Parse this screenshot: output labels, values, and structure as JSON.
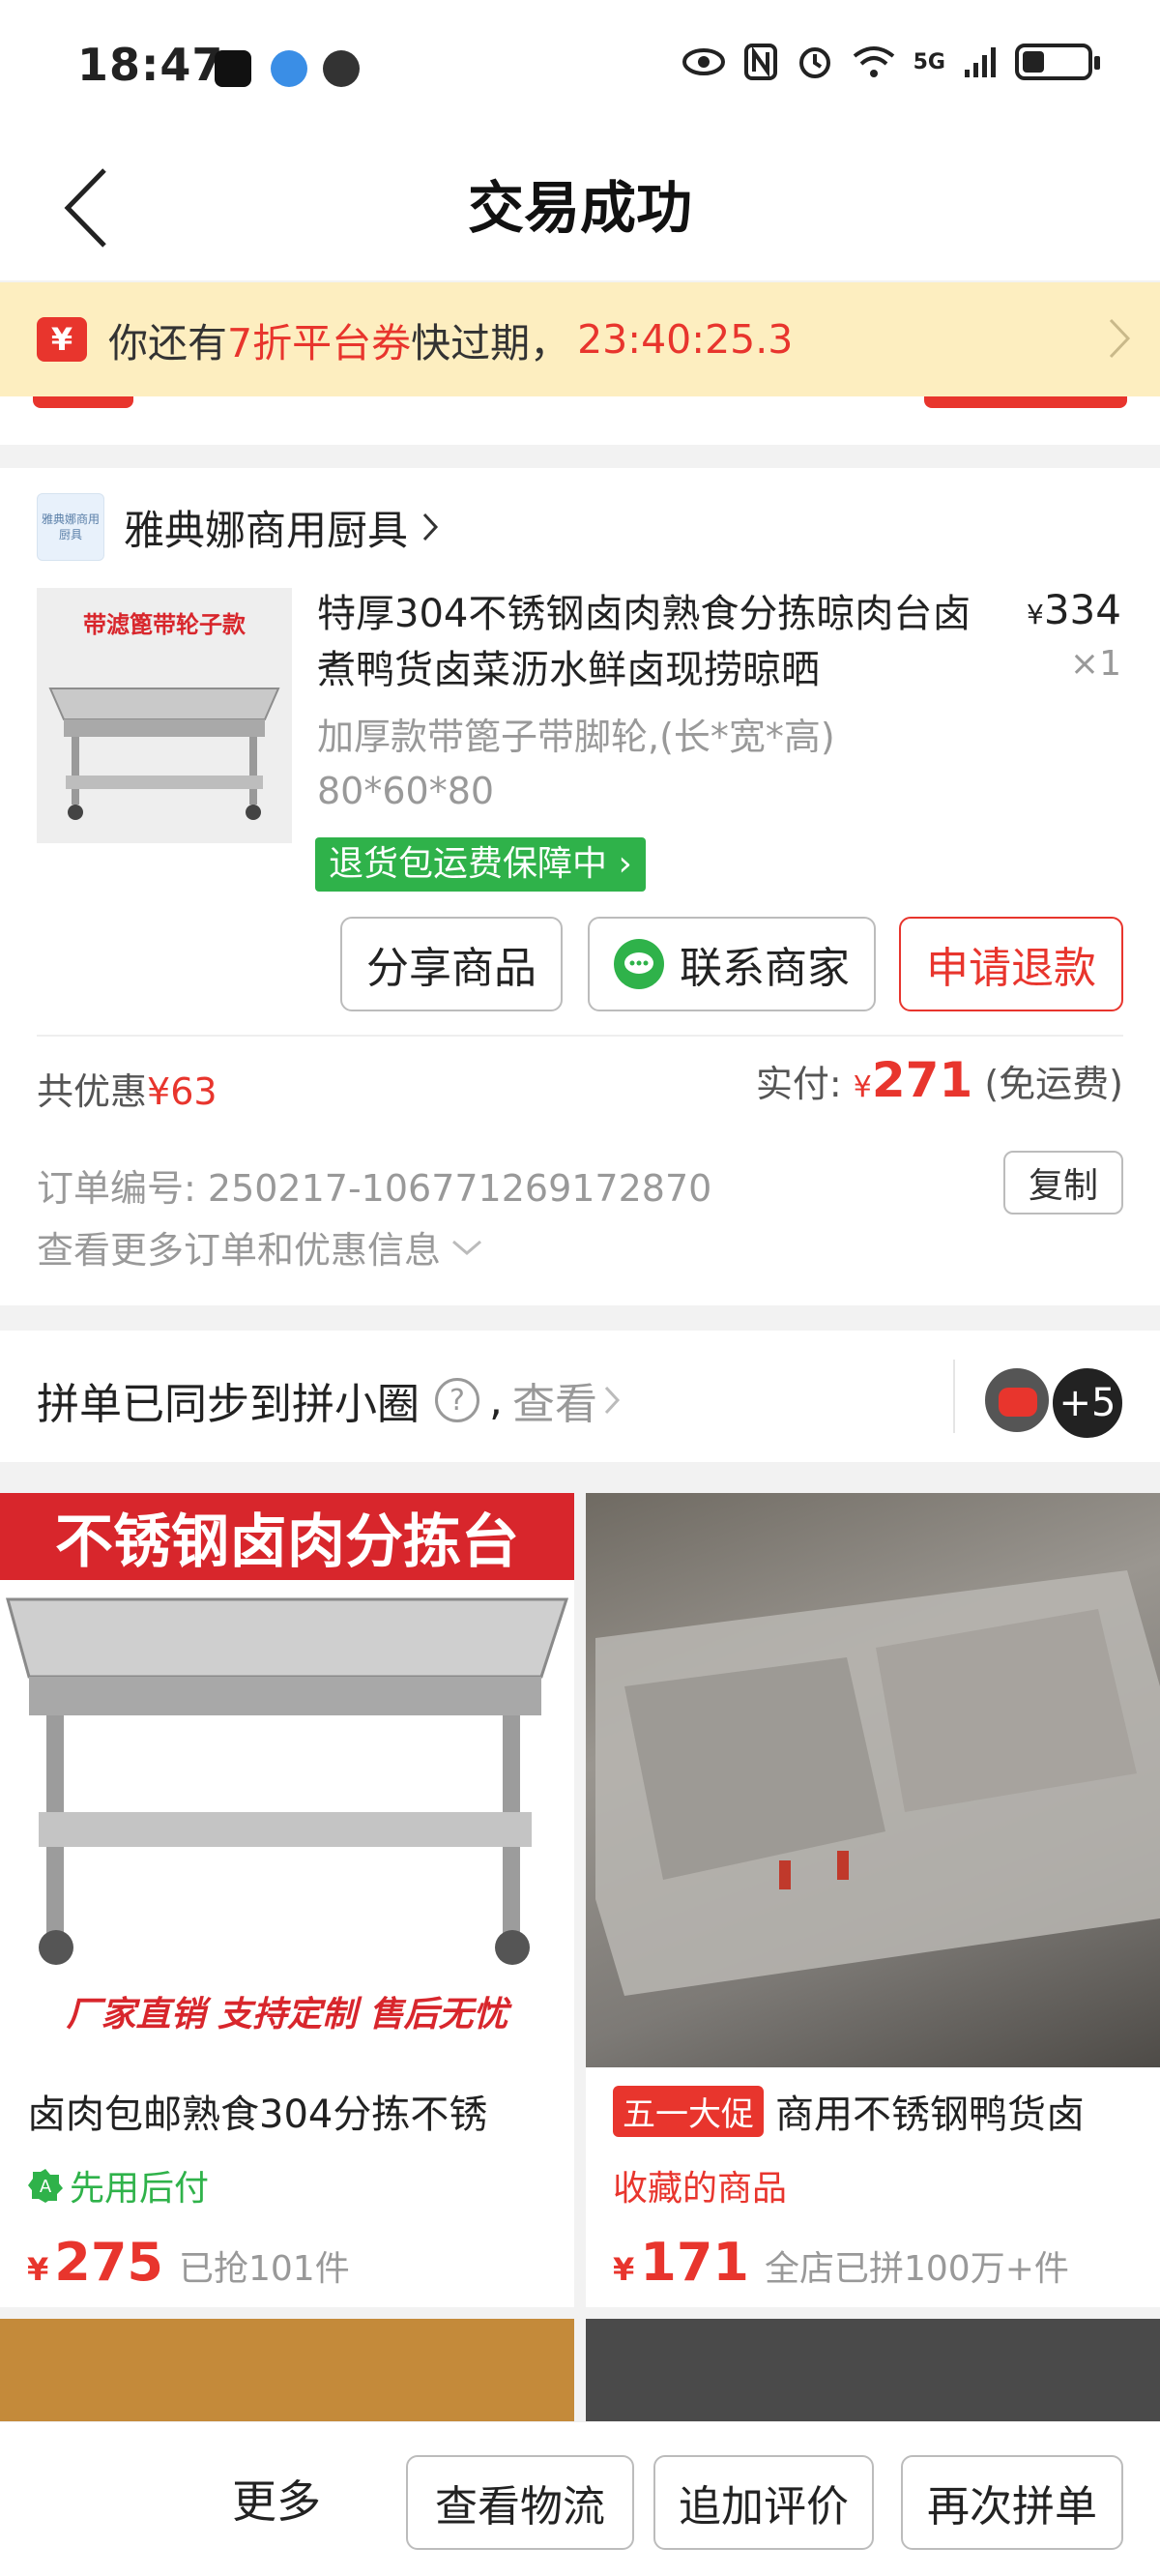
{
  "status_bar": {
    "time": "18:47",
    "network": "5G"
  },
  "nav": {
    "title": "交易成功"
  },
  "coupon": {
    "tag": "¥",
    "text_before": "你还有",
    "highlight": "7折平台券",
    "text_after": "快过期，",
    "countdown": "23:40:25.3"
  },
  "order": {
    "shop_logo_text": "雅典娜商用厨具",
    "shop_name": "雅典娜商用厨具",
    "image_caption": "带滤篦带轮子款",
    "title": "特厚304不锈钢卤肉熟食分拣晾肉台卤煮鸭货卤菜沥水鲜卤现捞晾晒",
    "currency": "¥",
    "price": "334",
    "quantity": "×1",
    "spec": "加厚款带篦子带脚轮,(长*宽*高) 80*60*80",
    "guarantee": "退货包运费保障中",
    "buttons": {
      "share": "分享商品",
      "contact": "联系商家",
      "refund": "申请退款"
    },
    "discount_label": "共优惠",
    "discount_value": "¥63",
    "paid_label": "实付: ",
    "paid_currency": "¥",
    "paid_amount": "271",
    "shipping": " (免运费)",
    "order_no_label": "订单编号: ",
    "order_no": "250217-106771269172870",
    "copy": "复制",
    "more_info": "查看更多订单和优惠信息"
  },
  "sync": {
    "text": "拼单已同步到拼小圈",
    "help": "?",
    "comma": ",",
    "look": "查看",
    "avatar_count": "+5"
  },
  "recommendations": [
    {
      "banner": "不锈钢卤肉分拣台",
      "slogan": "厂家直销  支持定制  售后无忧",
      "title": "卤肉包邮熟食304分拣不锈",
      "sub": "先用后付",
      "currency": "¥",
      "price": "275",
      "sold": "已抢101件"
    },
    {
      "promo": "五一大促",
      "title": "商用不锈钢鸭货卤",
      "sub": "收藏的商品",
      "currency": "¥",
      "price": "171",
      "sold": "全店已拼100万+件"
    }
  ],
  "bottom_bar": {
    "more": "更多",
    "logistics": "查看物流",
    "review": "追加评价",
    "reorder": "再次拼单"
  },
  "colors": {
    "accent": "#e8352d",
    "green": "#2fb24a",
    "coupon_bg": "#fdeec0"
  }
}
